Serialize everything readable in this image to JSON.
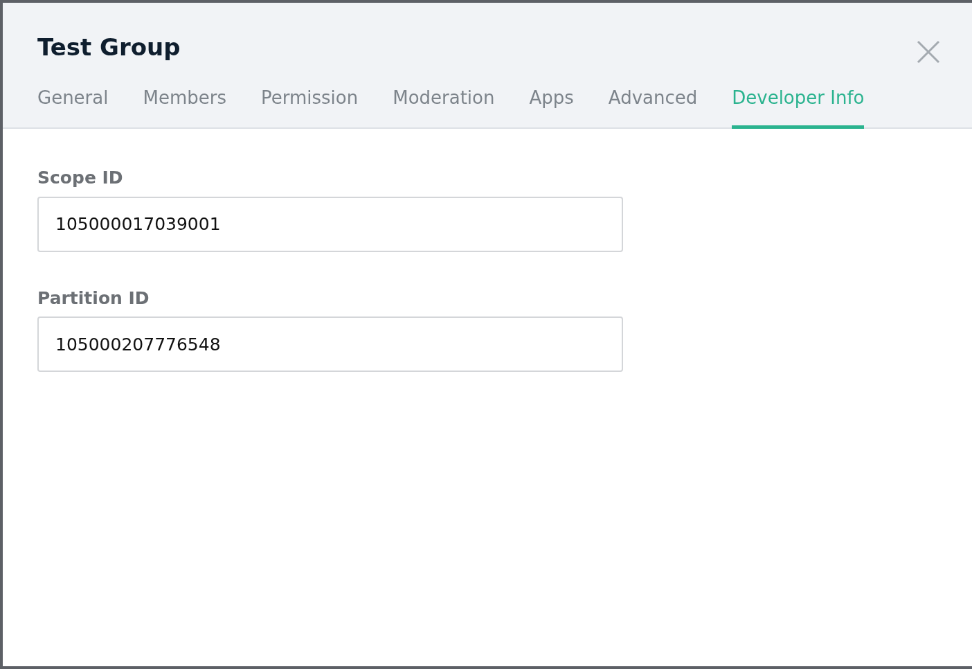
{
  "dialog": {
    "title": "Test Group"
  },
  "tabs": [
    {
      "label": "General",
      "selected": false
    },
    {
      "label": "Members",
      "selected": false
    },
    {
      "label": "Permission",
      "selected": false
    },
    {
      "label": "Moderation",
      "selected": false
    },
    {
      "label": "Apps",
      "selected": false
    },
    {
      "label": "Advanced",
      "selected": false
    },
    {
      "label": "Developer Info",
      "selected": true
    }
  ],
  "fields": [
    {
      "label": "Scope ID",
      "value": "105000017039001"
    },
    {
      "label": "Partition ID",
      "value": "105000207776548"
    }
  ]
}
